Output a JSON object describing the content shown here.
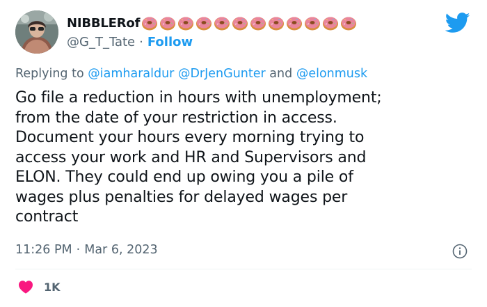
{
  "user": {
    "display_name": "NIBBLERof",
    "handle": "@G_T_Tate",
    "separator": "·",
    "follow_label": "Follow",
    "donut_emoji_count": 12,
    "avatar_icon": "profile-photo"
  },
  "reply": {
    "prefix": "Replying to",
    "mention_1": "@iamharaldur",
    "mention_2": "@DrJenGunter",
    "joiner": "and",
    "mention_3": "@elonmusk"
  },
  "tweet": {
    "lines": [
      "Go file a reduction in hours with unemployment;",
      "from the date of your restriction in access.",
      "Document your hours every morning trying to",
      "access your work and HR and Supervisors and",
      "ELON. They could end up owing you a pile of",
      "wages plus penalties for delayed wages per",
      "contract"
    ]
  },
  "meta": {
    "time": "11:26 PM",
    "separator": "·",
    "date": "Mar 6, 2023"
  },
  "engagement": {
    "like_count": "1K"
  },
  "colors": {
    "accent": "#1d9bf0",
    "muted": "#536471",
    "text": "#0f1419",
    "heart": "#f91880"
  }
}
